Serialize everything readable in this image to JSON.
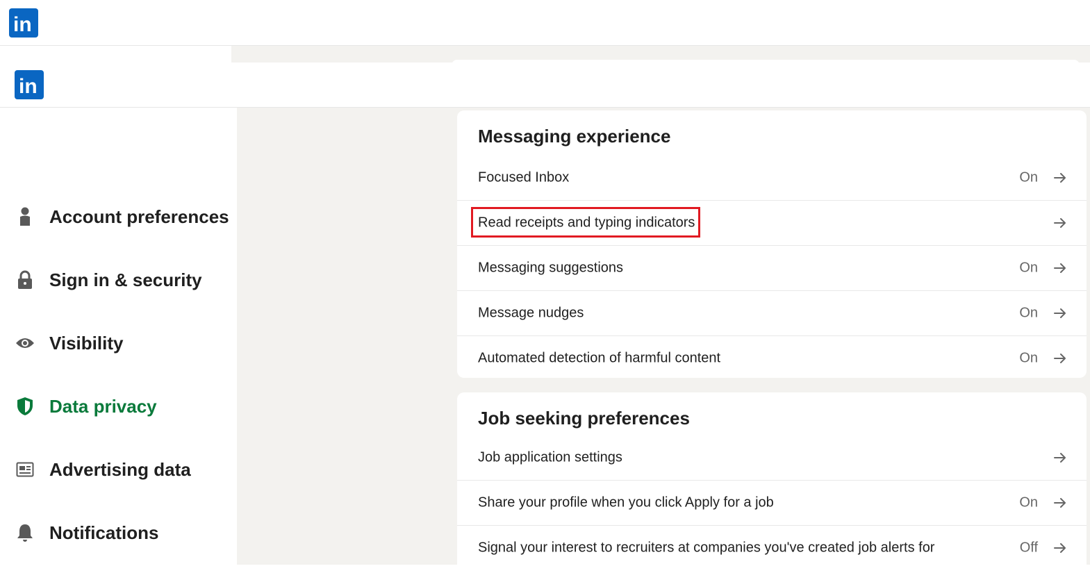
{
  "colors": {
    "brand": "#0a66c2",
    "active_nav": "#0a7a3b",
    "highlight": "#e11a22",
    "background": "#f3f2ef"
  },
  "header": {
    "logo_text": "in",
    "logo_icon": "linkedin-logo-icon"
  },
  "sidebar": {
    "items": [
      {
        "label": "Account preferences",
        "icon": "person-icon",
        "active": false
      },
      {
        "label": "Sign in & security",
        "icon": "lock-icon",
        "active": false
      },
      {
        "label": "Visibility",
        "icon": "eye-icon",
        "active": false
      },
      {
        "label": "Data privacy",
        "icon": "shield-icon",
        "active": true
      },
      {
        "label": "Advertising data",
        "icon": "newspaper-icon",
        "active": false
      },
      {
        "label": "Notifications",
        "icon": "bell-icon",
        "active": false
      }
    ]
  },
  "main": {
    "sections": [
      {
        "title": "Messaging experience",
        "rows": [
          {
            "label": "Focused Inbox",
            "status": "On"
          },
          {
            "label": "Read receipts and typing indicators",
            "status": "",
            "highlighted": true
          },
          {
            "label": "Messaging suggestions",
            "status": "On"
          },
          {
            "label": "Message nudges",
            "status": "On"
          },
          {
            "label": "Automated detection of harmful content",
            "status": "On"
          }
        ]
      },
      {
        "title": "Job seeking preferences",
        "rows": [
          {
            "label": "Job application settings",
            "status": ""
          },
          {
            "label": "Share your profile when you click Apply for a job",
            "status": "On"
          },
          {
            "label": "Signal your interest to recruiters at companies you've created job alerts for",
            "status": "Off"
          }
        ]
      }
    ]
  }
}
